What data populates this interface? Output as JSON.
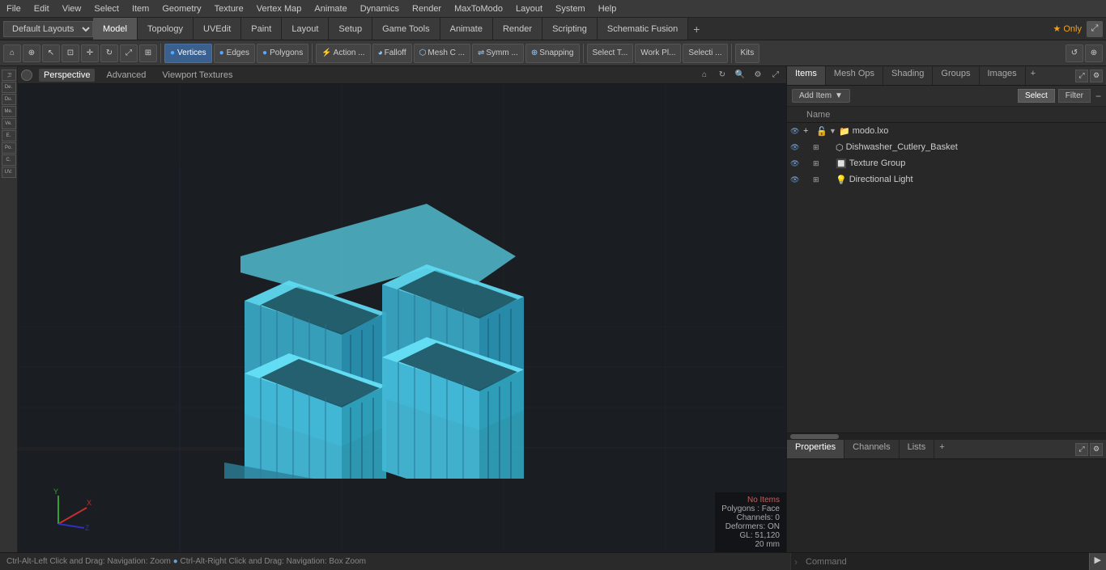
{
  "menubar": {
    "items": [
      "File",
      "Edit",
      "View",
      "Select",
      "Item",
      "Geometry",
      "Texture",
      "Vertex Map",
      "Animate",
      "Dynamics",
      "Render",
      "MaxToModo",
      "Layout",
      "System",
      "Help"
    ]
  },
  "layout_bar": {
    "dropdown": "Default Layouts",
    "tabs": [
      "Model",
      "Topology",
      "UVEdit",
      "Paint",
      "Layout",
      "Setup",
      "Game Tools",
      "Animate",
      "Render",
      "Scripting",
      "Schematic Fusion"
    ],
    "active_tab": "Model",
    "add_icon": "+",
    "star_label": "★ Only"
  },
  "toolbar": {
    "icons": [
      "⊕",
      "◎",
      "⌖",
      "⊞",
      "⬚",
      "⊙",
      "⌒",
      "⬡"
    ],
    "mode_buttons": [
      "Vertices",
      "Edges",
      "Polygons"
    ],
    "action_buttons": [
      "Action ...",
      "Falloff",
      "Mesh C ...",
      "Symm ...",
      "Snapping",
      "Select T...",
      "Work Pl...",
      "Selecti ...",
      "Kits"
    ],
    "right_icons": [
      "↺",
      "⊕"
    ]
  },
  "viewport": {
    "tabs": [
      "Perspective",
      "Advanced",
      "Viewport Textures"
    ],
    "active_tab": "Perspective",
    "status": {
      "no_items": "No Items",
      "polygons": "Polygons : Face",
      "channels": "Channels: 0",
      "deformers": "Deformers: ON",
      "gl": "GL: 51,120",
      "measure": "20 mm"
    }
  },
  "right_panel": {
    "tabs": [
      "Items",
      "Mesh Ops",
      "Shading",
      "Groups",
      "Images"
    ],
    "active_tab": "Items",
    "add_tab_icon": "+",
    "header": {
      "add_item_label": "Add Item",
      "dropdown_arrow": "▼",
      "select_label": "Select",
      "filter_label": "Filter",
      "minus_icon": "−"
    },
    "column_header": "Name",
    "tree": [
      {
        "id": "root",
        "eye": true,
        "indent": 0,
        "hasArrow": true,
        "icon": "📦",
        "label": "modo.lxo",
        "selected": false
      },
      {
        "id": "mesh",
        "eye": true,
        "indent": 1,
        "hasArrow": false,
        "icon": "⬡",
        "label": "Dishwasher_Cutlery_Basket",
        "selected": false
      },
      {
        "id": "texture",
        "eye": true,
        "indent": 1,
        "hasArrow": false,
        "icon": "🔲",
        "label": "Texture Group",
        "selected": false
      },
      {
        "id": "light",
        "eye": true,
        "indent": 1,
        "hasArrow": false,
        "icon": "💡",
        "label": "Directional Light",
        "selected": false
      }
    ]
  },
  "lower_right": {
    "tabs": [
      "Properties",
      "Channels",
      "Lists"
    ],
    "active_tab": "Properties",
    "add_tab_icon": "+"
  },
  "bottom_bar": {
    "hint": "Ctrl-Alt-Left Click and Drag: Navigation: Zoom",
    "dot": "●",
    "hint2": "Ctrl-Alt-Right Click and Drag: Navigation: Box Zoom",
    "cmd_placeholder": "Command",
    "run_icon": "▶"
  }
}
